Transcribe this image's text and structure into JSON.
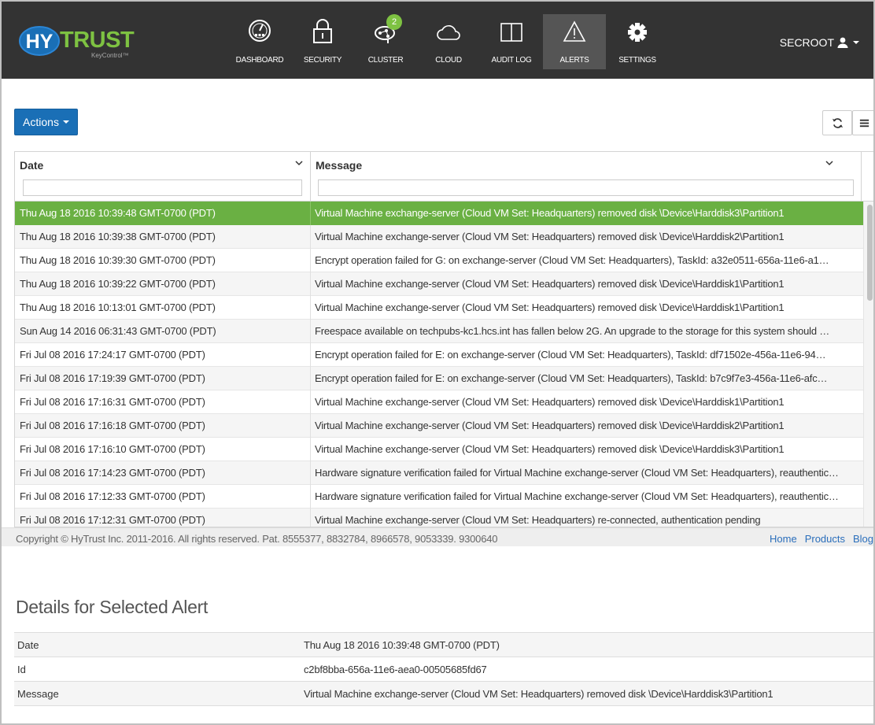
{
  "brand": {
    "logo_hy": "HY",
    "logo_trust": "TRUST",
    "logo_sub": "KeyControl™"
  },
  "nav": [
    {
      "label": "DASHBOARD",
      "icon": "dashboard-icon"
    },
    {
      "label": "SECURITY",
      "icon": "lock-icon"
    },
    {
      "label": "CLUSTER",
      "icon": "cluster-icon",
      "badge": "2"
    },
    {
      "label": "CLOUD",
      "icon": "cloud-icon"
    },
    {
      "label": "AUDIT LOG",
      "icon": "book-icon"
    },
    {
      "label": "ALERTS",
      "icon": "warning-icon",
      "active": true
    },
    {
      "label": "SETTINGS",
      "icon": "gear-icon"
    }
  ],
  "user": {
    "name": "SECROOT"
  },
  "toolbar": {
    "actions_label": "Actions"
  },
  "grid": {
    "columns": [
      {
        "label": "Date"
      },
      {
        "label": "Message"
      }
    ],
    "rows": [
      {
        "date": "Thu Aug 18 2016 10:39:48 GMT-0700 (PDT)",
        "message": "Virtual Machine exchange-server (Cloud VM Set: Headquarters) removed disk \\Device\\Harddisk3\\Partition1",
        "selected": true
      },
      {
        "date": "Thu Aug 18 2016 10:39:38 GMT-0700 (PDT)",
        "message": "Virtual Machine exchange-server (Cloud VM Set: Headquarters) removed disk \\Device\\Harddisk2\\Partition1"
      },
      {
        "date": "Thu Aug 18 2016 10:39:30 GMT-0700 (PDT)",
        "message": "Encrypt operation failed for G: on exchange-server (Cloud VM Set: Headquarters), TaskId: a32e0511-656a-11e6-a1…"
      },
      {
        "date": "Thu Aug 18 2016 10:39:22 GMT-0700 (PDT)",
        "message": "Virtual Machine exchange-server (Cloud VM Set: Headquarters) removed disk \\Device\\Harddisk1\\Partition1"
      },
      {
        "date": "Thu Aug 18 2016 10:13:01 GMT-0700 (PDT)",
        "message": "Virtual Machine exchange-server (Cloud VM Set: Headquarters) removed disk \\Device\\Harddisk1\\Partition1"
      },
      {
        "date": "Sun Aug 14 2016 06:31:43 GMT-0700 (PDT)",
        "message": "Freespace available on techpubs-kc1.hcs.int has fallen below 2G. An upgrade to the storage for this system should …"
      },
      {
        "date": "Fri Jul 08 2016 17:24:17 GMT-0700 (PDT)",
        "message": "Encrypt operation failed for E: on exchange-server (Cloud VM Set: Headquarters), TaskId: df71502e-456a-11e6-94…"
      },
      {
        "date": "Fri Jul 08 2016 17:19:39 GMT-0700 (PDT)",
        "message": "Encrypt operation failed for E: on exchange-server (Cloud VM Set: Headquarters), TaskId: b7c9f7e3-456a-11e6-afc…"
      },
      {
        "date": "Fri Jul 08 2016 17:16:31 GMT-0700 (PDT)",
        "message": "Virtual Machine exchange-server (Cloud VM Set: Headquarters) removed disk \\Device\\Harddisk1\\Partition1"
      },
      {
        "date": "Fri Jul 08 2016 17:16:18 GMT-0700 (PDT)",
        "message": "Virtual Machine exchange-server (Cloud VM Set: Headquarters) removed disk \\Device\\Harddisk2\\Partition1"
      },
      {
        "date": "Fri Jul 08 2016 17:16:10 GMT-0700 (PDT)",
        "message": "Virtual Machine exchange-server (Cloud VM Set: Headquarters) removed disk \\Device\\Harddisk3\\Partition1"
      },
      {
        "date": "Fri Jul 08 2016 17:14:23 GMT-0700 (PDT)",
        "message": "Hardware signature verification failed for Virtual Machine exchange-server (Cloud VM Set: Headquarters), reauthentic…"
      },
      {
        "date": "Fri Jul 08 2016 17:12:33 GMT-0700 (PDT)",
        "message": "Hardware signature verification failed for Virtual Machine exchange-server (Cloud VM Set: Headquarters), reauthentic…"
      },
      {
        "date": "Fri Jul 08 2016 17:12:31 GMT-0700 (PDT)",
        "message": "Virtual Machine exchange-server (Cloud VM Set: Headquarters) re-connected, authentication pending"
      }
    ]
  },
  "footer": {
    "copyright": "Copyright © HyTrust Inc. 2011-2016. All rights reserved. Pat. 8555377, 8832784, 8966578, 9053339. 9300640",
    "links": [
      "Home",
      "Products",
      "Blog"
    ]
  },
  "details": {
    "title": "Details for Selected Alert",
    "rows": [
      {
        "key": "Date",
        "value": "Thu Aug 18 2016 10:39:48 GMT-0700 (PDT)"
      },
      {
        "key": "Id",
        "value": "c2bf8bba-656a-11e6-aea0-00505685fd67"
      },
      {
        "key": "Message",
        "value": "Virtual Machine exchange-server (Cloud VM Set: Headquarters) removed disk \\Device\\Harddisk3\\Partition1"
      }
    ]
  },
  "colors": {
    "navbar": "#333333",
    "accent_green": "#6ab043",
    "brand_blue": "#1a6fb6",
    "link_blue": "#2a6ebb"
  }
}
